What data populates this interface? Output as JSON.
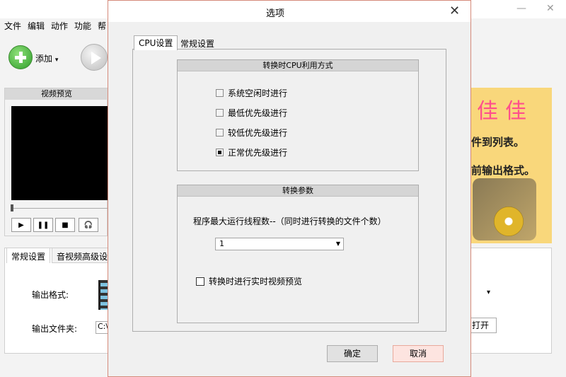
{
  "main": {
    "menu": [
      "文件",
      "编辑",
      "动作",
      "功能",
      "帮"
    ],
    "toolbar": {
      "add_label": "添加",
      "add_dropdown": "▾"
    },
    "preview": {
      "title": "视频预览",
      "controls": [
        "▶",
        "❚❚",
        "■",
        "🎧"
      ]
    },
    "bottom_tabs": [
      "常规设置",
      "音视频高级设"
    ],
    "output_format_label": "输出格式:",
    "output_folder_label": "输出文件夹:",
    "output_folder_value": "C:\\",
    "banner": {
      "big": "佳佳",
      "line1": "件到列表。",
      "line2": "前输出格式。"
    },
    "open_button": "打开"
  },
  "dialog": {
    "title": "选项",
    "close": "✕",
    "tabs": [
      "CPU设置",
      "常规设置"
    ],
    "cpu_group": {
      "title": "转换时CPU利用方式",
      "options": [
        {
          "label": "系统空闲时进行",
          "checked": false
        },
        {
          "label": "最低优先级进行",
          "checked": false
        },
        {
          "label": "较低优先级进行",
          "checked": false
        },
        {
          "label": "正常优先级进行",
          "checked": true
        }
      ]
    },
    "param_group": {
      "title": "转换参数",
      "thread_text": "程序最大运行线程数--（同时进行转换的文件个数）",
      "thread_value": "1",
      "realtime_preview": "转换时进行实时视频预览"
    },
    "ok": "确定",
    "cancel": "取消"
  }
}
